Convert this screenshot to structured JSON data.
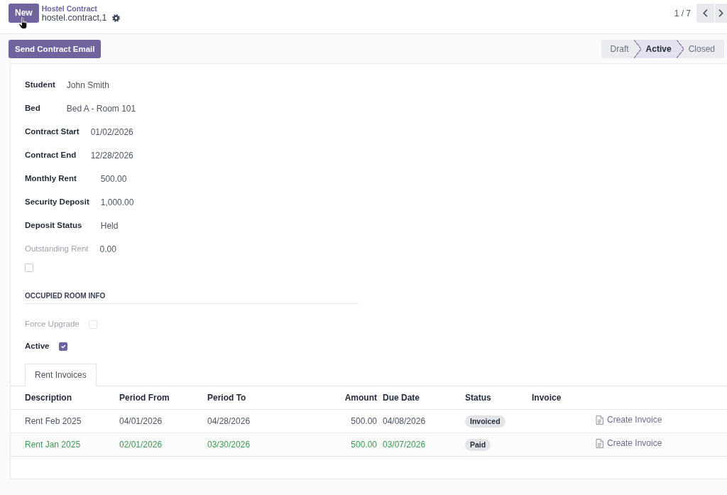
{
  "header": {
    "new_button": "New",
    "breadcrumb": "Hostel Contract",
    "record_title": "hostel.contract,1",
    "pager": "1 / 7"
  },
  "control_bar": {
    "action_button": "Send Contract Email",
    "stages": [
      {
        "label": "Draft",
        "selected": false
      },
      {
        "label": "Active",
        "selected": true
      },
      {
        "label": "Closed",
        "selected": false
      }
    ]
  },
  "form": {
    "field_groups": [
      [
        {
          "label": "Student",
          "value": "John Smith",
          "muted": false
        },
        {
          "label": "Bed",
          "value": "Bed A - Room 101",
          "muted": false
        }
      ],
      [
        {
          "label": "Contract Start",
          "value": "01/02/2026",
          "muted": false
        },
        {
          "label": "Contract End",
          "value": "12/28/2026",
          "muted": false
        }
      ],
      [
        {
          "label": "Monthly Rent",
          "value": "500.00",
          "muted": false
        },
        {
          "label": "Security Deposit",
          "value": "1,000.00",
          "muted": false
        },
        {
          "label": "Deposit Status",
          "value": "Held",
          "muted": false
        }
      ],
      [
        {
          "label": "Outstanding Rent",
          "value": "0.00",
          "muted": true
        }
      ]
    ],
    "checkbox": {
      "checked": false
    },
    "section": {
      "title": "OCCUPIED ROOM INFO",
      "fields": [
        {
          "label": "Force Upgrade",
          "checked": false,
          "disabled": true
        },
        {
          "label": "Active",
          "checked": true,
          "disabled": false
        }
      ]
    }
  },
  "tabs": [
    {
      "label": "Rent Invoices",
      "selected": true
    }
  ],
  "table": {
    "columns": [
      "Description",
      "Period From",
      "Period To",
      "Amount",
      "Due Date",
      "Status",
      "Invoice"
    ],
    "rows": [
      {
        "description": "Rent Feb 2025",
        "period_from": "04/01/2026",
        "period_to": "04/28/2026",
        "amount": "500.00",
        "due_date": "04/08/2026",
        "status": "Invoiced",
        "action": "Create Invoice",
        "success": false
      },
      {
        "description": "Rent Jan 2025",
        "period_from": "02/01/2026",
        "period_to": "03/30/2026",
        "amount": "500.00",
        "due_date": "03/07/2026",
        "status": "Paid",
        "action": "Create Invoice",
        "success": true
      }
    ]
  }
}
